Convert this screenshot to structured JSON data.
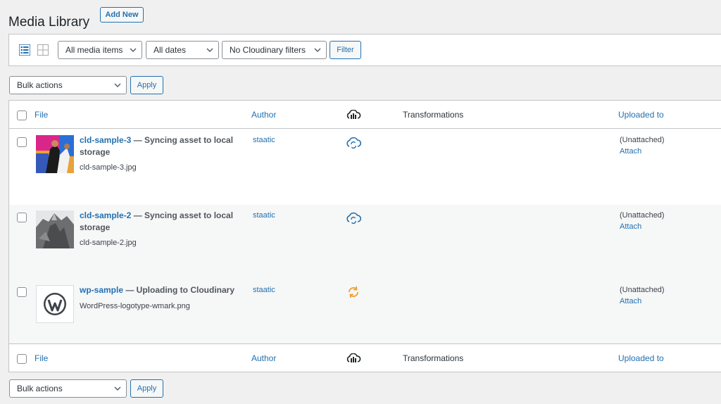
{
  "header": {
    "title": "Media Library",
    "add_new_label": "Add New"
  },
  "filters": {
    "media_type": "All media items",
    "dates": "All dates",
    "cloudinary": "No Cloudinary filters",
    "filter_label": "Filter"
  },
  "bulk": {
    "top_label": "Bulk actions",
    "top_apply": "Apply",
    "bottom_label": "Bulk actions",
    "bottom_apply": "Apply"
  },
  "columns": {
    "file": "File",
    "author": "Author",
    "cloudinary_icon": "cloudinary-cloud-icon",
    "transformations": "Transformations",
    "uploaded_to": "Uploaded to"
  },
  "rows": [
    {
      "title": "cld-sample-3",
      "status": " — Syncing asset to local storage",
      "filename": "cld-sample-3.jpg",
      "author": "staatic",
      "status_icon": "cloud-sync-icon",
      "uploaded_to": "(Unattached)",
      "attach": "Attach"
    },
    {
      "title": "cld-sample-2",
      "status": " — Syncing asset to local storage",
      "filename": "cld-sample-2.jpg",
      "author": "staatic",
      "status_icon": "cloud-sync-icon",
      "uploaded_to": "(Unattached)",
      "attach": "Attach"
    },
    {
      "title": "wp-sample",
      "status": " — Uploading to Cloudinary",
      "filename": "WordPress-logotype-wmark.png",
      "author": "staatic",
      "status_icon": "refresh-icon",
      "uploaded_to": "(Unattached)",
      "attach": "Attach"
    }
  ],
  "colors": {
    "accent": "#2271b1",
    "sync_icon": "#2271b1",
    "upload_icon": "#f0a030",
    "alt_row": "#f6f7f7"
  }
}
